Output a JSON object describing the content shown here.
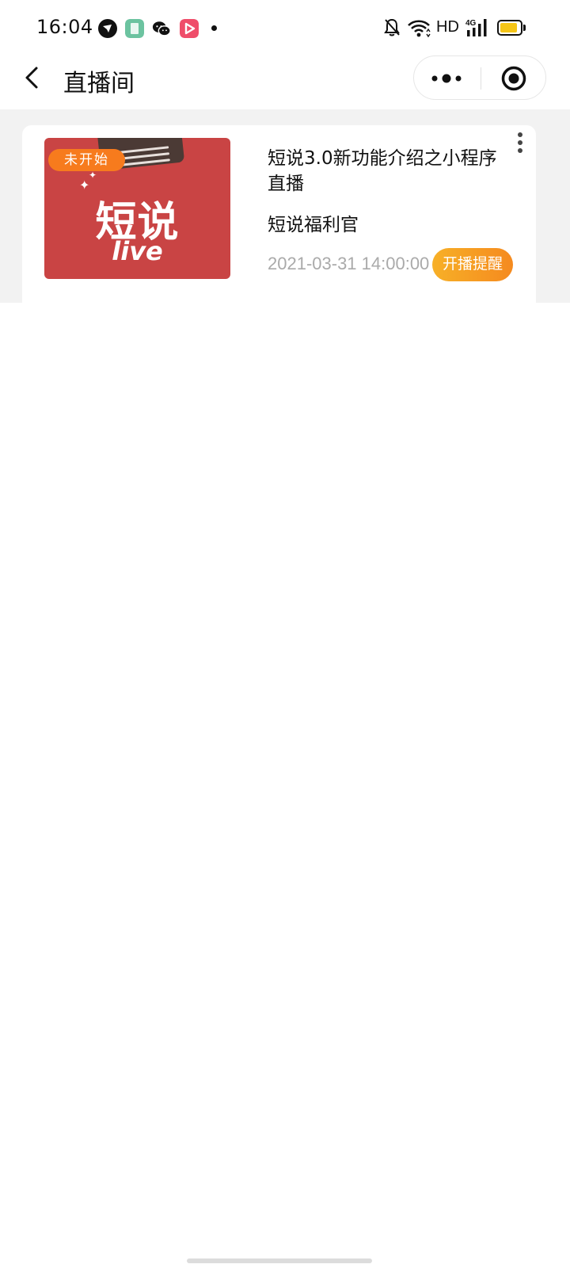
{
  "status_bar": {
    "time": "16:04",
    "network": "HD",
    "cellular": "4G",
    "icons": [
      "feishu-icon",
      "reader-app-icon",
      "wechat-icon",
      "video-app-icon",
      "notification-dot",
      "bell-mute-icon",
      "wifi-icon",
      "signal-icon",
      "battery-icon"
    ],
    "battery_level": 0.8,
    "battery_color": "#f5c518"
  },
  "nav": {
    "title": "直播间",
    "icons": [
      "back-arrow-icon",
      "more-dots-icon",
      "close-circle-icon"
    ]
  },
  "live_card": {
    "cover": {
      "title": "短说",
      "subtitle": "live",
      "background": "#c94444"
    },
    "status_badge": "未开始",
    "title": "短说3.0新功能介绍之小程序直播",
    "host": "短说福利官",
    "start_time": "2021-03-31 14:00:00",
    "remind_label": "开播提醒",
    "badge_color": "#f77b1d",
    "accent": "#f58a1f"
  }
}
